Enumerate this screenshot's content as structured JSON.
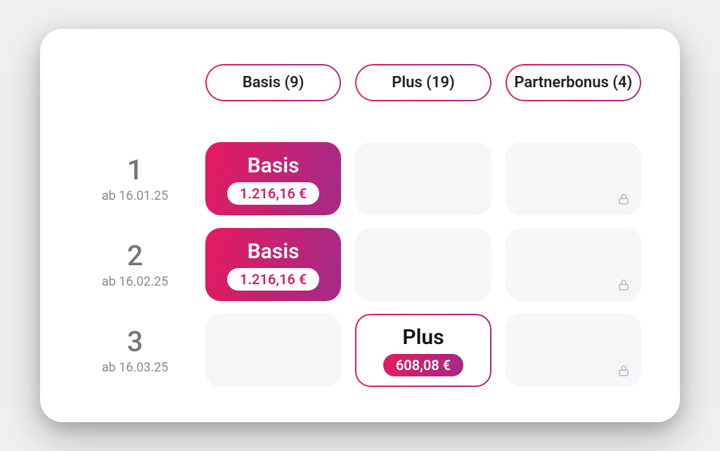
{
  "columns": {
    "basis": {
      "label": "Basis (9)"
    },
    "plus": {
      "label": "Plus (19)"
    },
    "partnerbonus": {
      "label": "Partnerbonus (4)"
    }
  },
  "rows": [
    {
      "number": "1",
      "date_prefix": "ab 16.01.25",
      "basis": {
        "title": "Basis",
        "price": "1.216,16 €"
      },
      "partner_locked": true
    },
    {
      "number": "2",
      "date_prefix": "ab 16.02.25",
      "basis": {
        "title": "Basis",
        "price": "1.216,16 €"
      },
      "partner_locked": true
    },
    {
      "number": "3",
      "date_prefix": "ab 16.03.25",
      "plus": {
        "title": "Plus",
        "price": "608,08 €"
      },
      "partner_locked": true
    }
  ]
}
